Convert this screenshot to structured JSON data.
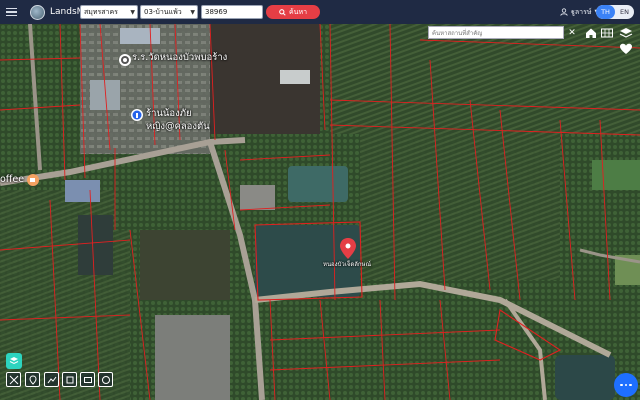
{
  "app": {
    "brand": "LandsMaps"
  },
  "search": {
    "province": "สมุทรสาคร",
    "district": "03-บ้านแพ้ว",
    "parcel_number": "38969",
    "button_label": "ค้นหา"
  },
  "header": {
    "user_label": "ฐูลารษ์",
    "lang_active": "TH",
    "lang_other": "EN"
  },
  "map": {
    "place_search_placeholder": "ค้นหาสถานที่สำคัญ",
    "labels": {
      "school": "ร.ร.วัดหนองบัวพบอร้าง",
      "shop": "ร้านน้องภัย",
      "shop2": "หญิง@คลองตัน",
      "coffee": "offee",
      "pin_label": "หนองบัวเจ็ดลักษณ์"
    }
  },
  "colors": {
    "topbar": "#1f2a44",
    "accent_red": "#e53e45",
    "parcel_lines": "#e02020",
    "lang_active": "#3b82f6",
    "fab": "#1e6fff"
  },
  "icons": [
    "hamburger-icon",
    "globe-logo-icon",
    "search-icon",
    "user-icon",
    "home-icon",
    "grid-icon",
    "layers-icon",
    "heart-icon",
    "close-icon",
    "location-pin-icon",
    "coffee-icon",
    "info-icon",
    "measure-icon",
    "pin-tool-icon",
    "line-tool-icon",
    "polygon-tool-icon",
    "rectangle-tool-icon",
    "circle-tool-icon",
    "more-icon"
  ]
}
